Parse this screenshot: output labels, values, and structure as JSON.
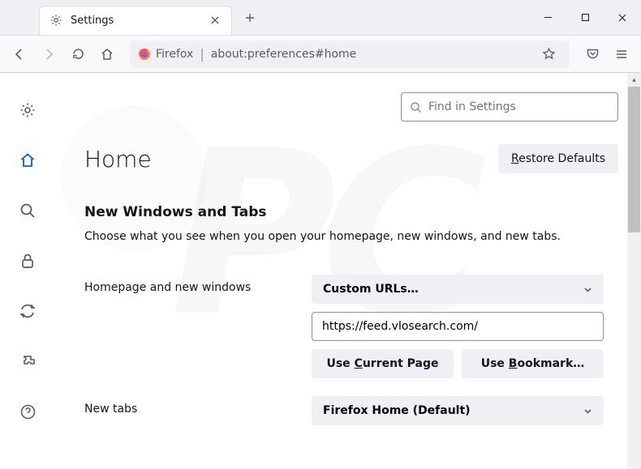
{
  "tab": {
    "title": "Settings"
  },
  "urlbar": {
    "identity": "Firefox",
    "url": "about:preferences#home"
  },
  "search": {
    "placeholder": "Find in Settings"
  },
  "page": {
    "title": "Home",
    "restore": "Restore Defaults",
    "restore_ul": "R"
  },
  "section": {
    "title": "New Windows and Tabs",
    "desc": "Choose what you see when you open your homepage, new windows, and new tabs."
  },
  "homepage": {
    "label": "Homepage and new windows",
    "select": "Custom URLs…",
    "url": "https://feed.vlosearch.com/",
    "use_current": "Use Current Page",
    "use_current_ul": "C",
    "use_bookmark": "Use Bookmark…",
    "use_bookmark_ul": "B"
  },
  "newtabs": {
    "label": "New tabs",
    "select": "Firefox Home (Default)"
  }
}
